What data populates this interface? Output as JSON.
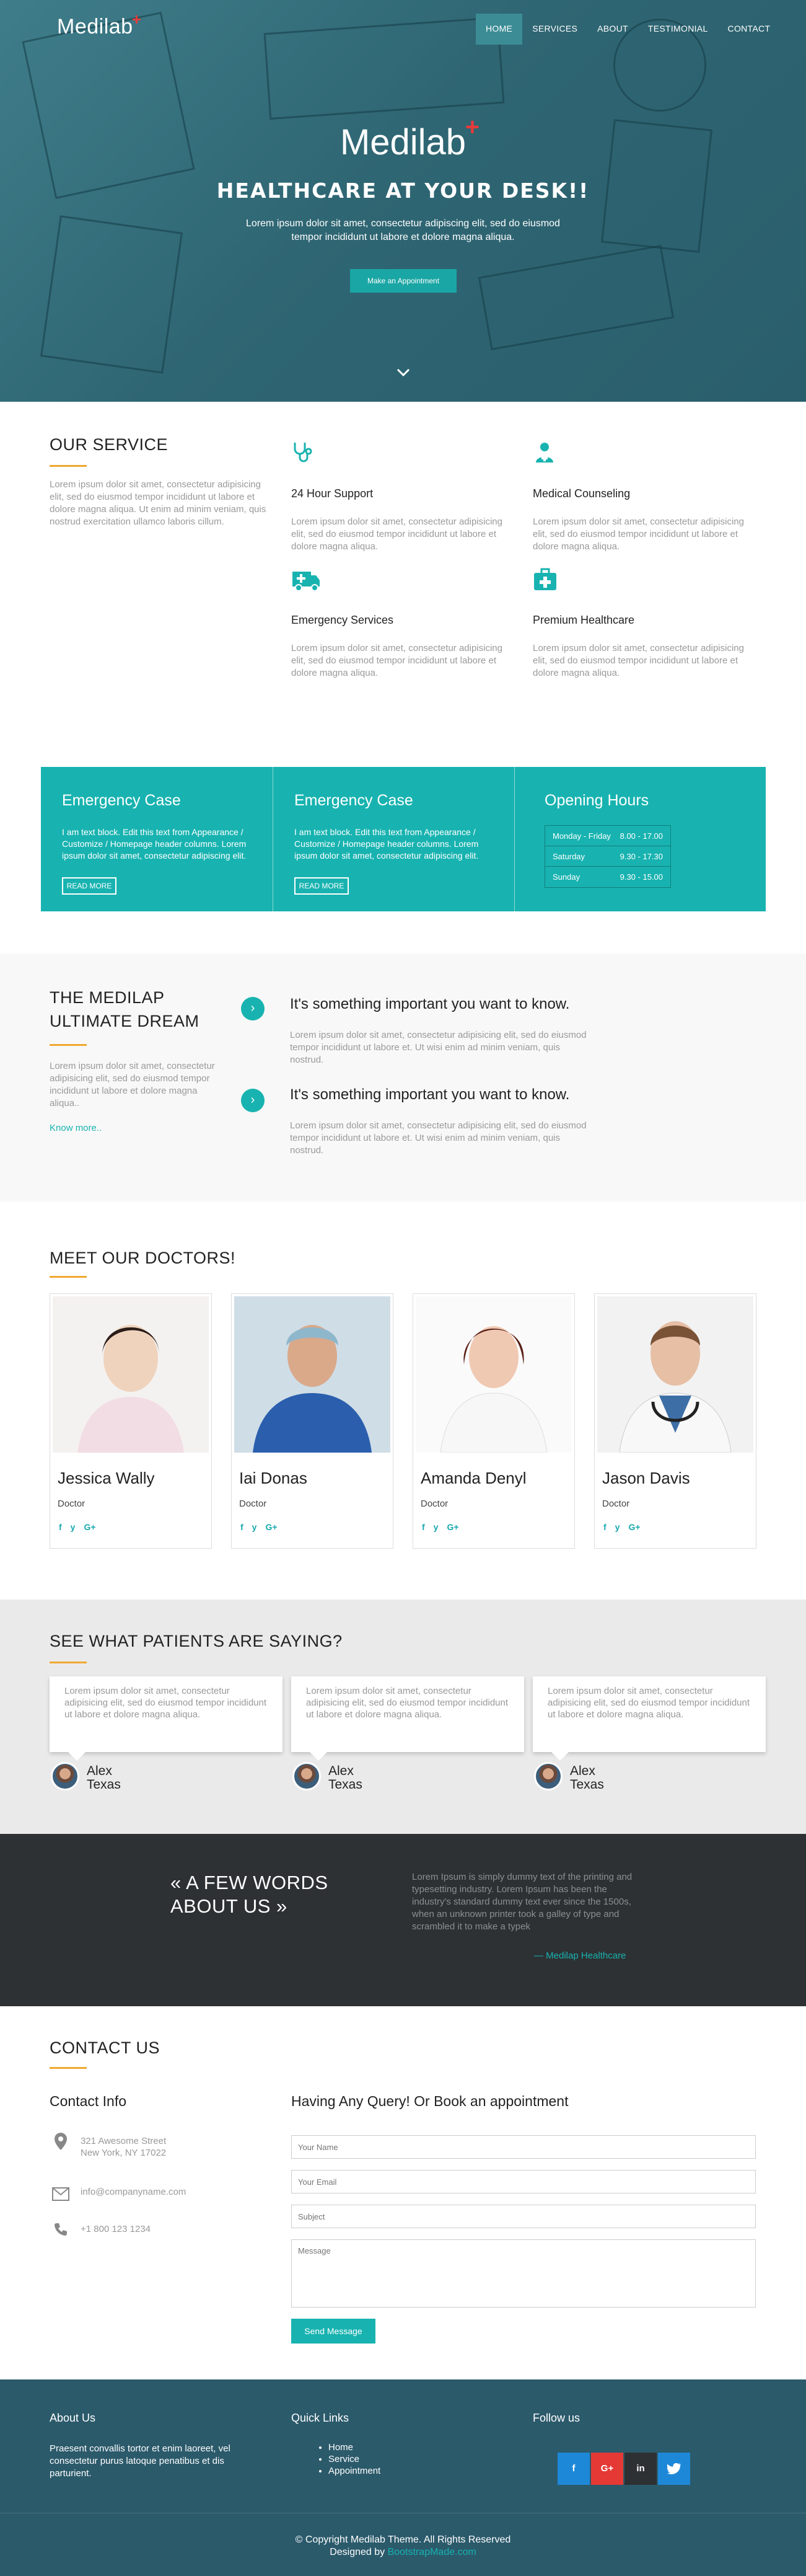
{
  "brand": {
    "name": "Medilab",
    "plus": "+"
  },
  "nav": [
    "HOME",
    "SERVICES",
    "ABOUT",
    "TESTIMONIAL",
    "CONTACT"
  ],
  "hero": {
    "logo": "Medilab",
    "tagline": "HEALTHCARE AT YOUR DESK!!",
    "subtitle": "Lorem ipsum dolor sit amet, consectetur adipiscing elit, sed do eiusmod tempor incididunt ut labore et dolore magna aliqua.",
    "button": "Make an Appointment",
    "down_icon": "chevron-down-icon"
  },
  "service": {
    "title": "OUR SERVICE",
    "text": "Lorem ipsum dolor sit amet, consectetur adipisicing elit, sed do eiusmod tempor incididunt ut labore et dolore magna aliqua. Ut enim ad minim veniam, quis nostrud exercitation ullamco laboris cillum.",
    "items": [
      {
        "title": "24 Hour Support",
        "text": "Lorem ipsum dolor sit amet, consectetur adipisicing elit, sed do eiusmod tempor incididunt ut labore et dolore magna aliqua.",
        "icon": "stethoscope-icon"
      },
      {
        "title": "Medical Counseling",
        "text": "Lorem ipsum dolor sit amet, consectetur adipisicing elit, sed do eiusmod tempor incididunt ut labore et dolore magna aliqua.",
        "icon": "doctor-icon"
      },
      {
        "title": "Emergency Services",
        "text": "Lorem ipsum dolor sit amet, consectetur adipisicing elit, sed do eiusmod tempor incididunt ut labore et dolore magna aliqua.",
        "icon": "ambulance-icon"
      },
      {
        "title": "Premium Healthcare",
        "text": "Lorem ipsum dolor sit amet, consectetur adipisicing elit, sed do eiusmod tempor incididunt ut labore et dolore magna aliqua.",
        "icon": "medkit-icon"
      }
    ]
  },
  "band": {
    "cols": [
      {
        "title": "Emergency Case",
        "text": "I am text block. Edit this text from Appearance / Customize / Homepage header columns. Lorem ipsum dolor sit amet, consectetur adipiscing elit.",
        "button": "READ MORE"
      },
      {
        "title": "Emergency Case",
        "text": "I am text block. Edit this text from Appearance / Customize / Homepage header columns. Lorem ipsum dolor sit amet, consectetur adipiscing elit.",
        "button": "READ MORE"
      }
    ],
    "hours_title": "Opening Hours",
    "hours": [
      {
        "day": "Monday - Friday",
        "time": "8.00 - 17.00"
      },
      {
        "day": "Saturday",
        "time": "9.30 - 17.30"
      },
      {
        "day": "Sunday",
        "time": "9.30 - 15.00"
      }
    ]
  },
  "dream": {
    "title_line1": "THE MEDILAP",
    "title_line2": "ULTIMATE DREAM",
    "text": "Lorem ipsum dolor sit amet, consectetur adipisicing elit, sed do eiusmod tempor incididunt ut labore et dolore magna aliqua..",
    "link": "Know more..",
    "items": [
      {
        "title": "It's something important you want to know.",
        "text": "Lorem ipsum dolor sit amet, consectetur adipisicing elit, sed do eiusmod tempor incididunt ut labore et. Ut wisi enim ad minim veniam, quis nostrud."
      },
      {
        "title": "It's something important you want to know.",
        "text": "Lorem ipsum dolor sit amet, consectetur adipisicing elit, sed do eiusmod tempor incididunt ut labore et. Ut wisi enim ad minim veniam, quis nostrud."
      }
    ]
  },
  "doctors": {
    "title": "MEET OUR DOCTORS!",
    "list": [
      {
        "name": "Jessica Wally",
        "role": "Doctor"
      },
      {
        "name": "Iai Donas",
        "role": "Doctor"
      },
      {
        "name": "Amanda Denyl",
        "role": "Doctor"
      },
      {
        "name": "Jason Davis",
        "role": "Doctor"
      }
    ],
    "social": [
      "f",
      "y",
      "G+"
    ]
  },
  "testimonials": {
    "title": "SEE WHAT PATIENTS ARE SAYING?",
    "list": [
      {
        "text": "Lorem ipsum dolor sit amet, consectetur adipisicing elit, sed do eiusmod tempor incididunt ut labore et dolore magna aliqua.",
        "name": "Alex",
        "place": "Texas"
      },
      {
        "text": "Lorem ipsum dolor sit amet, consectetur adipisicing elit, sed do eiusmod tempor incididunt ut labore et dolore magna aliqua.",
        "name": "Alex",
        "place": "Texas"
      },
      {
        "text": "Lorem ipsum dolor sit amet, consectetur adipisicing elit, sed do eiusmod tempor incididunt ut labore et dolore magna aliqua.",
        "name": "Alex",
        "place": "Texas"
      }
    ]
  },
  "about": {
    "title_line1": "« A FEW WORDS",
    "title_line2": "ABOUT US »",
    "text": "Lorem Ipsum is simply dummy text of the printing and typesetting industry. Lorem Ipsum has been the industry's standard dummy text ever since the 1500s, when an unknown printer took a galley of type and scrambled it to make a typek",
    "signature": "— Medilap Healthcare"
  },
  "contact": {
    "title": "CONTACT US",
    "info_title": "Contact Info",
    "address1": "321 Awesome Street",
    "address2": "New York, NY 17022",
    "email": "info@companyname.com",
    "phone": "+1 800 123 1234",
    "form_title": "Having Any Query! Or Book an appointment",
    "ph_name": "Your Name",
    "ph_email": "Your Email",
    "ph_subject": "Subject",
    "ph_message": "Message",
    "send": "Send Message"
  },
  "footer": {
    "about_title": "About Us",
    "about_text": "Praesent convallis tortor et enim laoreet, vel consectetur purus latoque penatibus et dis parturient.",
    "links_title": "Quick Links",
    "links": [
      "Home",
      "Service",
      "Appointment"
    ],
    "follow_title": "Follow us",
    "social": [
      {
        "label": "f",
        "color": "#1e88d8"
      },
      {
        "label": "G+",
        "color": "#e53935"
      },
      {
        "label": "in",
        "color": "#2d3133"
      },
      {
        "label": "t",
        "color": "#1e88d8"
      }
    ],
    "copyright": "© Copyright Medilab Theme. All Rights Reserved",
    "designed_prefix": "Designed by",
    "designed_link": "BootstrapMade.com"
  }
}
